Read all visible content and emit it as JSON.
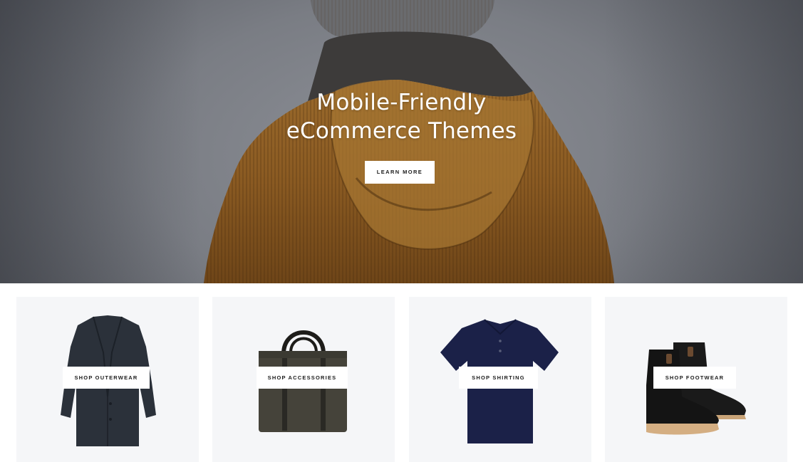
{
  "hero": {
    "title_line1": "Mobile-Friendly",
    "title_line2": "eCommerce Themes",
    "button_label": "LEARN MORE"
  },
  "collections": [
    {
      "label": "SHOP OUTERWEAR",
      "icon": "coat-image"
    },
    {
      "label": "SHOP ACCESSORIES",
      "icon": "bag-image"
    },
    {
      "label": "SHOP SHIRTING",
      "icon": "polo-shirt-image"
    },
    {
      "label": "SHOP FOOTWEAR",
      "icon": "boots-image"
    }
  ],
  "colors": {
    "tile_background": "#f5f6f8",
    "button_background": "#ffffff",
    "text_dark": "#1c1c1c",
    "hero_text": "#ffffff",
    "coat": "#2b313a",
    "bag": "#45433a",
    "shirt": "#1b2148",
    "boots": "#1a1a1a"
  }
}
